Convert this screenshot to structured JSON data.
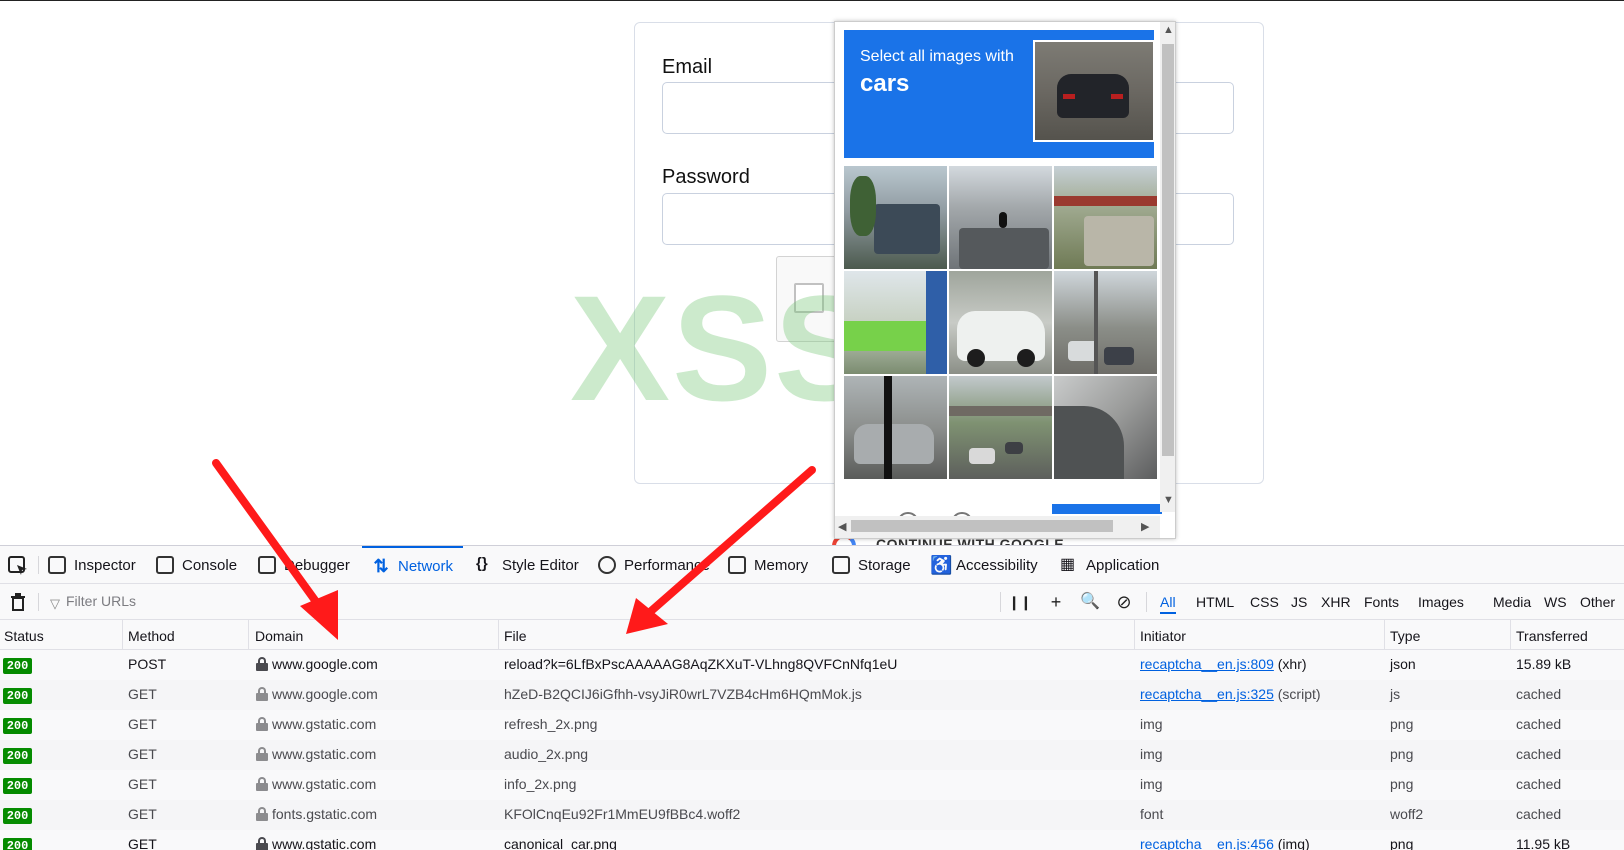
{
  "form": {
    "email_label": "Email",
    "password_label": "Password",
    "google_button_text": "CONTINUE WITH GOOGLE"
  },
  "captcha": {
    "instruction": "Select all images with",
    "keyword": "cars",
    "accent_color": "#1a73e8"
  },
  "watermark": "XSS.is",
  "devtools": {
    "tabs": [
      {
        "label": "Inspector",
        "icon": "inspector-icon"
      },
      {
        "label": "Console",
        "icon": "console-icon"
      },
      {
        "label": "Debugger",
        "icon": "debugger-icon"
      },
      {
        "label": "Network",
        "icon": "network-icon",
        "active": true
      },
      {
        "label": "Style Editor",
        "icon": "style-editor-icon"
      },
      {
        "label": "Performance",
        "icon": "performance-icon"
      },
      {
        "label": "Memory",
        "icon": "memory-icon"
      },
      {
        "label": "Storage",
        "icon": "storage-icon"
      },
      {
        "label": "Accessibility",
        "icon": "accessibility-icon"
      },
      {
        "label": "Application",
        "icon": "application-icon"
      }
    ],
    "filter_placeholder": "Filter URLs",
    "type_filters": [
      "All",
      "HTML",
      "CSS",
      "JS",
      "XHR",
      "Fonts",
      "Images",
      "Media",
      "WS",
      "Other"
    ],
    "active_type_filter": "All",
    "columns": [
      "Status",
      "Method",
      "Domain",
      "File",
      "Initiator",
      "Type",
      "Transferred"
    ],
    "rows": [
      {
        "status": "200",
        "method": "POST",
        "domain": "www.google.com",
        "file": "reload?k=6LfBxPscAAAAAG8AqZKXuT-VLhng8QVFCnNfq1eU",
        "initiator_link": "recaptcha__en.js:809",
        "initiator_note": "(xhr)",
        "type": "json",
        "transferred": "15.89 kB"
      },
      {
        "status": "200",
        "method": "GET",
        "domain": "www.google.com",
        "file": "hZeD-B2QCIJ6iGfhh-vsyJiR0wrL7VZB4cHm6HQmMok.js",
        "initiator_link": "recaptcha__en.js:325",
        "initiator_note": "(script)",
        "type": "js",
        "transferred": "cached"
      },
      {
        "status": "200",
        "method": "GET",
        "domain": "www.gstatic.com",
        "file": "refresh_2x.png",
        "initiator_link": "",
        "initiator_note": "img",
        "type": "png",
        "transferred": "cached"
      },
      {
        "status": "200",
        "method": "GET",
        "domain": "www.gstatic.com",
        "file": "audio_2x.png",
        "initiator_link": "",
        "initiator_note": "img",
        "type": "png",
        "transferred": "cached"
      },
      {
        "status": "200",
        "method": "GET",
        "domain": "www.gstatic.com",
        "file": "info_2x.png",
        "initiator_link": "",
        "initiator_note": "img",
        "type": "png",
        "transferred": "cached"
      },
      {
        "status": "200",
        "method": "GET",
        "domain": "fonts.gstatic.com",
        "file": "KFOlCnqEu92Fr1MmEU9fBBc4.woff2",
        "initiator_link": "",
        "initiator_note": "font",
        "type": "woff2",
        "transferred": "cached"
      },
      {
        "status": "200",
        "method": "GET",
        "domain": "www.gstatic.com",
        "file": "canonical_car.png",
        "initiator_link": "recaptcha__en.js:456",
        "initiator_note": "(img)",
        "type": "png",
        "transferred": "11.95 kB"
      }
    ],
    "status_color": "#058b00",
    "active_color": "#0061e0"
  },
  "annotation_color": "#ff1a1a"
}
